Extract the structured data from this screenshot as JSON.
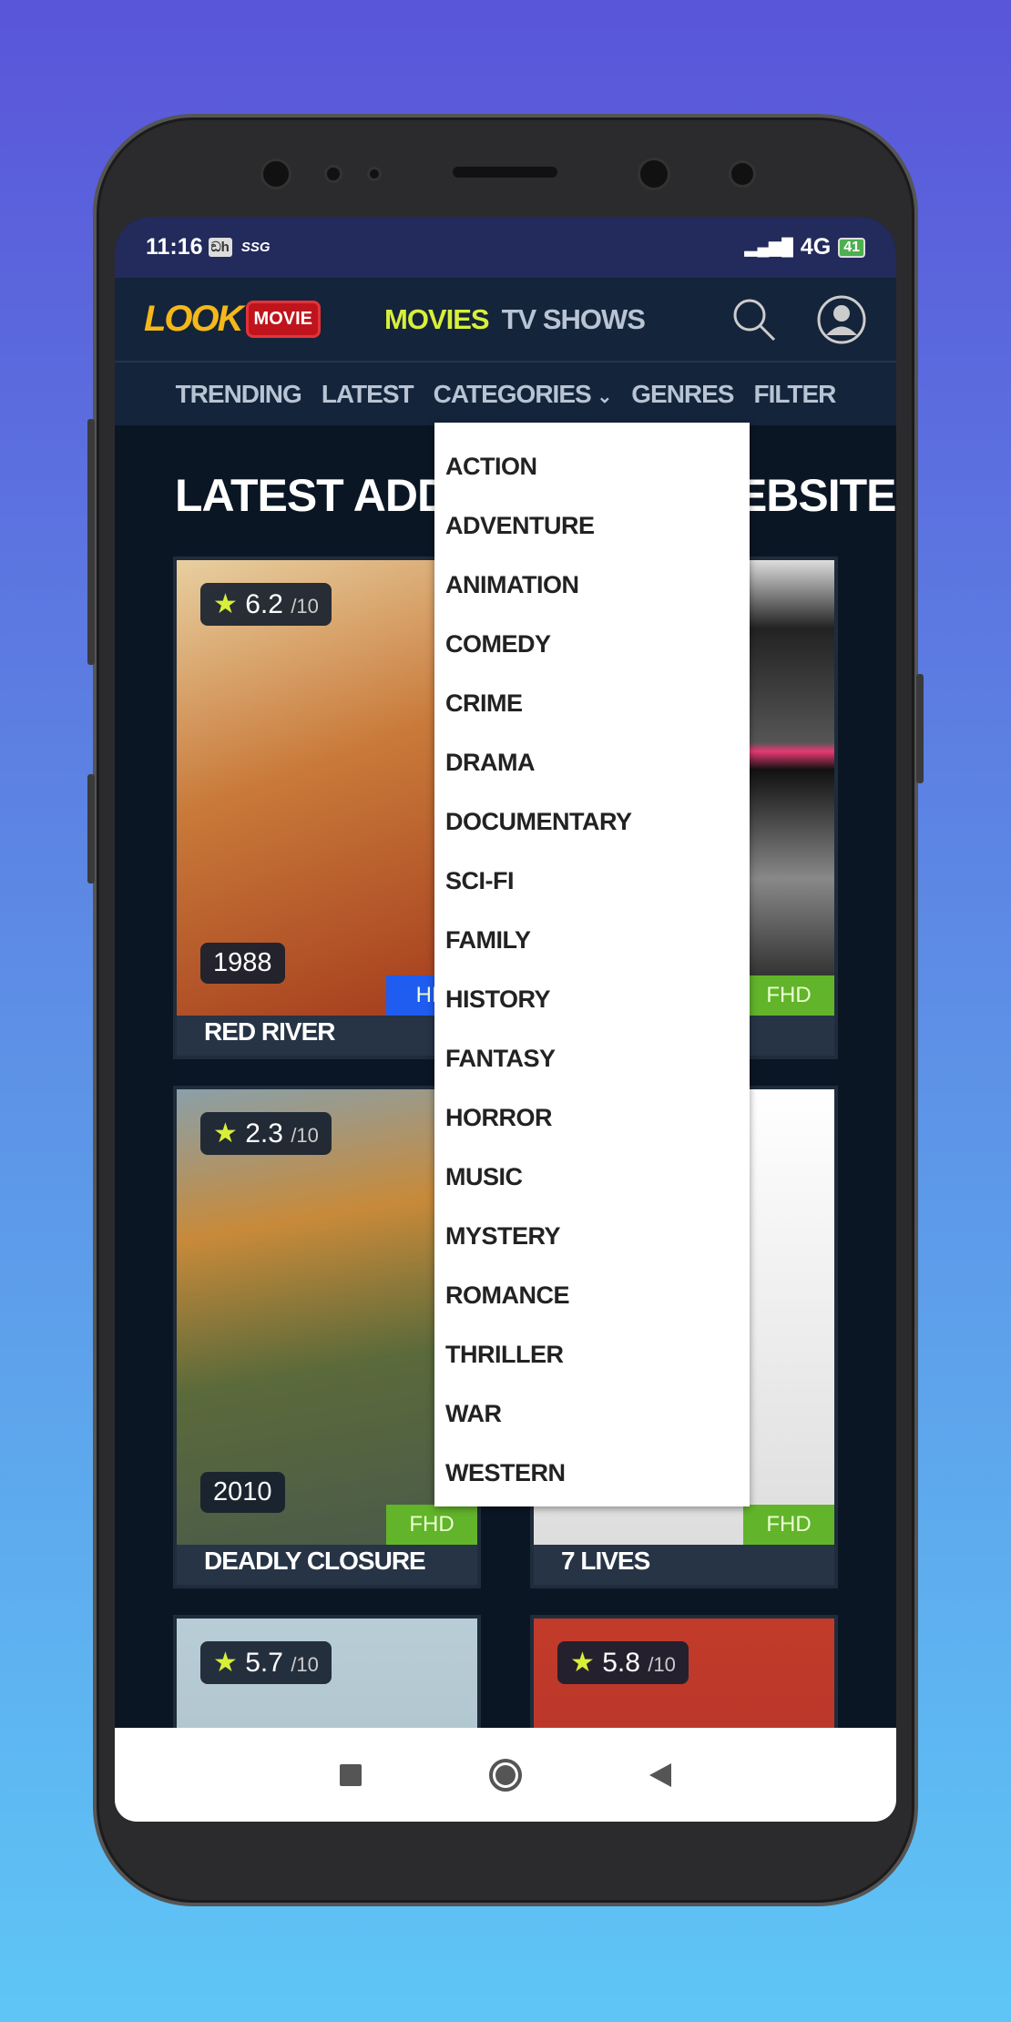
{
  "status": {
    "time": "11:16",
    "carrier_icon": "app-notification-icon",
    "extra": "SSG",
    "network": "4G",
    "battery": "41"
  },
  "header": {
    "logo_text_1": "LOOK",
    "logo_text_2": "MOVIE",
    "tabs": [
      {
        "label": "MOVIES",
        "active": true
      },
      {
        "label": "TV SHOWS",
        "active": false
      }
    ],
    "active_color": "#d8ef3a"
  },
  "subnav": {
    "items": [
      "TRENDING",
      "LATEST",
      "CATEGORIES",
      "GENRES",
      "FILTER"
    ]
  },
  "page_title": "LATEST ADDED TO THE WEBSITE",
  "cards": [
    {
      "title": "RED RIVER",
      "rating": "6.2",
      "rating_max": "/10",
      "year": "1988",
      "quality": "HD",
      "quality_color": "#1f5cf0"
    },
    {
      "title": "",
      "rating": "",
      "rating_max": "",
      "year": "",
      "quality": "FHD",
      "quality_color": "#62b42a"
    },
    {
      "title": "DEADLY CLOSURE",
      "rating": "2.3",
      "rating_max": "/10",
      "year": "2010",
      "quality": "FHD",
      "quality_color": "#62b42a"
    },
    {
      "title": "7 LIVES",
      "rating": "",
      "rating_max": "",
      "year": "",
      "quality": "FHD",
      "quality_color": "#62b42a"
    },
    {
      "title": "",
      "rating": "5.7",
      "rating_max": "/10",
      "year": "",
      "quality": "",
      "quality_color": ""
    },
    {
      "title": "",
      "rating": "5.8",
      "rating_max": "/10",
      "year": "",
      "quality": "",
      "quality_color": ""
    }
  ],
  "categories_dropdown": [
    "ACTION",
    "ADVENTURE",
    "ANIMATION",
    "COMEDY",
    "CRIME",
    "DRAMA",
    "DOCUMENTARY",
    "SCI-FI",
    "FAMILY",
    "HISTORY",
    "FANTASY",
    "HORROR",
    "MUSIC",
    "MYSTERY",
    "ROMANCE",
    "THRILLER",
    "WAR",
    "WESTERN"
  ]
}
